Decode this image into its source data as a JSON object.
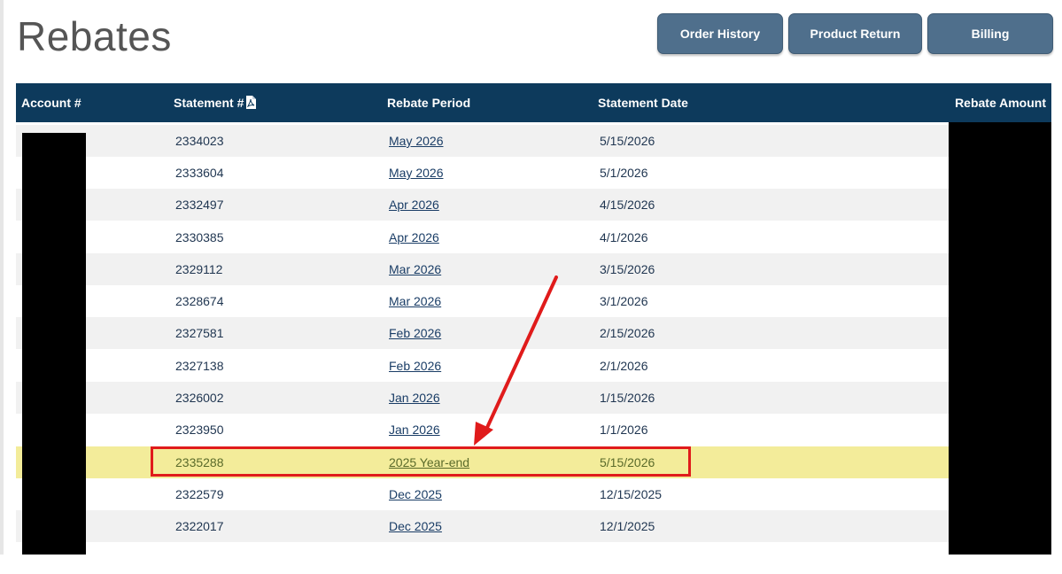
{
  "page": {
    "title": "Rebates"
  },
  "nav": {
    "order_history": "Order History",
    "product_return": "Product Return",
    "billing": "Billing"
  },
  "table": {
    "headers": {
      "account": "Account #",
      "statement": "Statement #",
      "rebate_period": "Rebate Period",
      "statement_date": "Statement Date",
      "rebate_amount": "Rebate Amount"
    },
    "rows": [
      {
        "statement": "2334023",
        "period": "May 2026",
        "date": "5/15/2026"
      },
      {
        "statement": "2333604",
        "period": "May 2026",
        "date": "5/1/2026"
      },
      {
        "statement": "2332497",
        "period": "Apr 2026",
        "date": "4/15/2026"
      },
      {
        "statement": "2330385",
        "period": "Apr 2026",
        "date": "4/1/2026"
      },
      {
        "statement": "2329112",
        "period": "Mar 2026",
        "date": "3/15/2026"
      },
      {
        "statement": "2328674",
        "period": "Mar 2026",
        "date": "3/1/2026"
      },
      {
        "statement": "2327581",
        "period": "Feb 2026",
        "date": "2/15/2026"
      },
      {
        "statement": "2327138",
        "period": "Feb 2026",
        "date": "2/1/2026"
      },
      {
        "statement": "2326002",
        "period": "Jan 2026",
        "date": "1/15/2026"
      },
      {
        "statement": "2323950",
        "period": "Jan 2026",
        "date": "1/1/2026"
      },
      {
        "statement": "2335288",
        "period": "2025 Year-end",
        "date": "5/15/2026"
      },
      {
        "statement": "2322579",
        "period": "Dec 2025",
        "date": "12/15/2025"
      },
      {
        "statement": "2322017",
        "period": "Dec 2025",
        "date": "12/1/2025"
      }
    ]
  },
  "icons": {
    "statement_header": "pdf-icon"
  },
  "colors": {
    "header_bg": "#0d3a5c",
    "button_bg": "#4f6f8c",
    "highlight_bg": "#f3ec9a",
    "annotation_red": "#e01b1b"
  }
}
